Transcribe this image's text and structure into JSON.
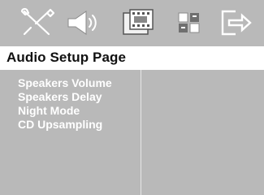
{
  "toolbar": {
    "icons": [
      {
        "name": "settings-tools-icon"
      },
      {
        "name": "speaker-audio-icon"
      },
      {
        "name": "film-video-icon"
      },
      {
        "name": "preference-grid-icon"
      },
      {
        "name": "exit-icon"
      }
    ]
  },
  "page": {
    "title": "Audio Setup Page"
  },
  "menu": {
    "items": [
      {
        "label": "Speakers Volume"
      },
      {
        "label": "Speakers Delay"
      },
      {
        "label": "Night Mode"
      },
      {
        "label": "CD Upsampling"
      }
    ]
  }
}
